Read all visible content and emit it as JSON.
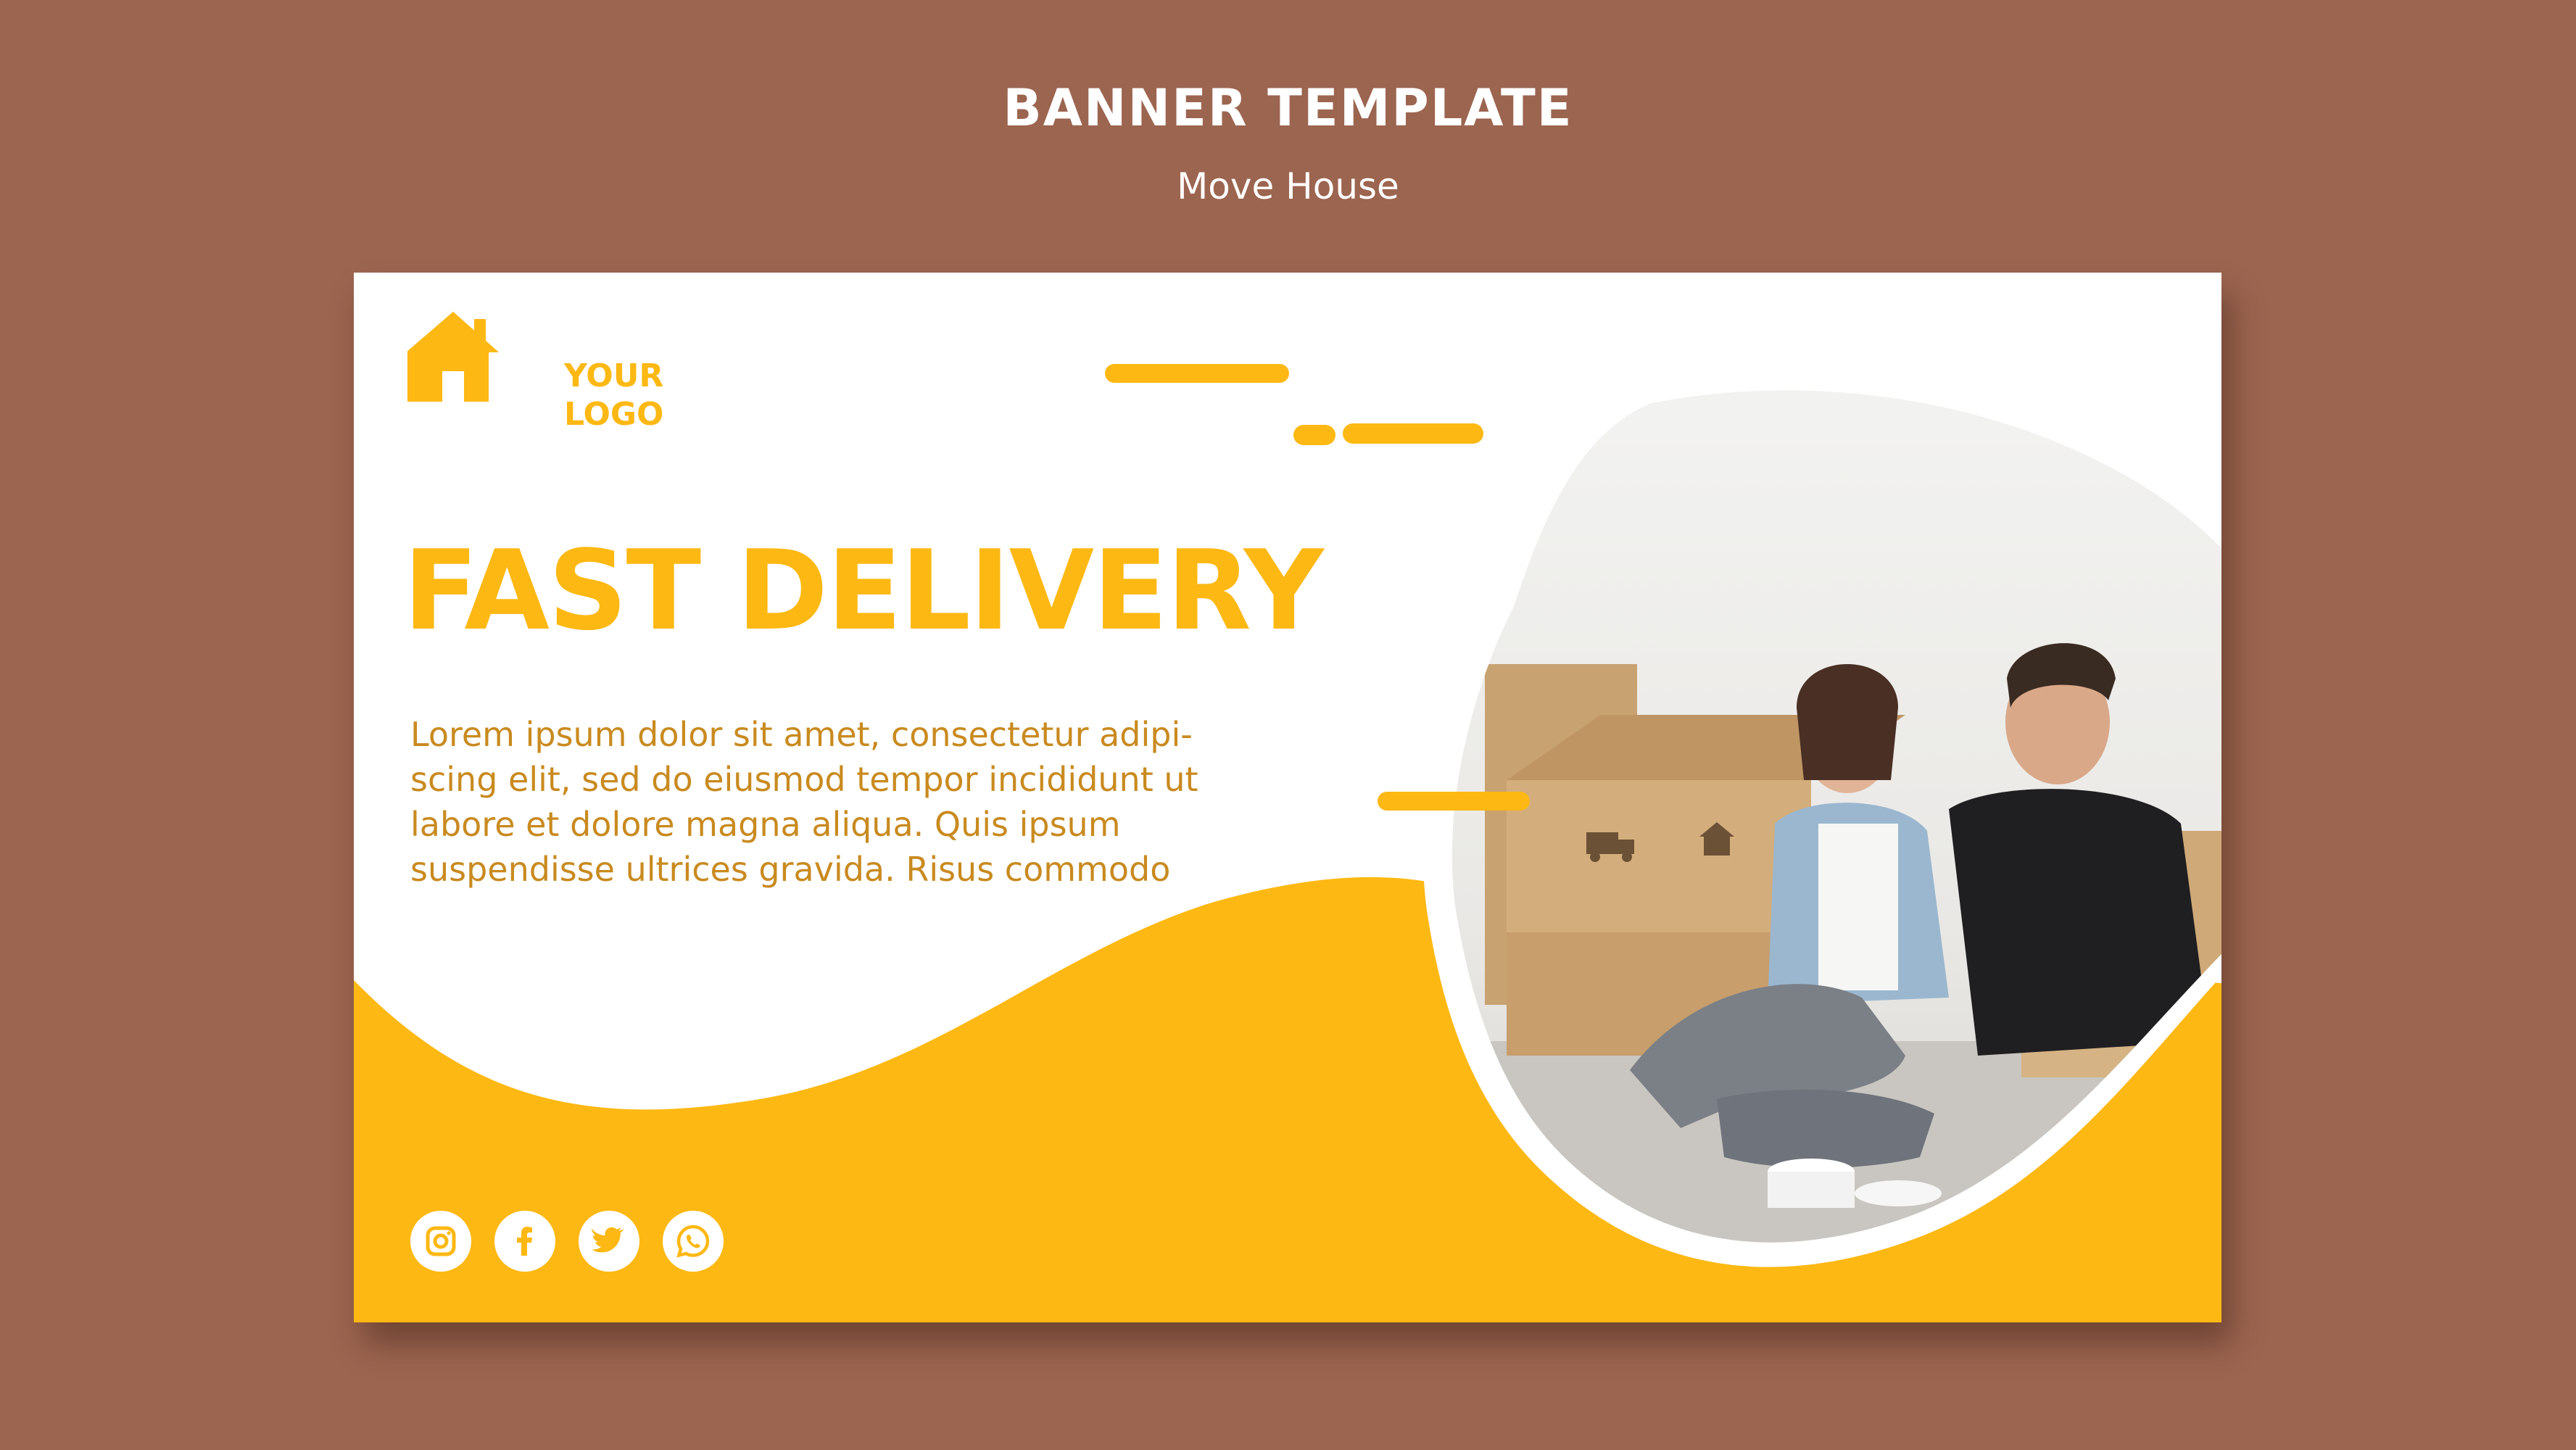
{
  "header": {
    "title": "BANNER TEMPLATE",
    "subtitle": "Move House"
  },
  "banner": {
    "logo": {
      "icon": "house-icon",
      "line1": "YOUR",
      "line2": "LOGO"
    },
    "headline": "FAST DELIVERY",
    "body_lines": [
      "Lorem ipsum dolor sit amet, consectetur adipi-",
      "scing elit, sed do eiusmod tempor incididunt ut",
      "labore et dolore magna aliqua. Quis ipsum",
      "suspendisse ultrices gravida. Risus commodo"
    ],
    "photo": {
      "box_icons": [
        "truck-icon",
        "house-icon"
      ]
    },
    "socials": [
      {
        "icon": "instagram-icon"
      },
      {
        "icon": "facebook-icon"
      },
      {
        "icon": "twitter-icon"
      },
      {
        "icon": "whatsapp-icon"
      }
    ]
  },
  "colors": {
    "page_background": "#9c6550",
    "accent_yellow": "#fdb813",
    "body_text": "#c98a1f",
    "banner_background": "#ffffff"
  }
}
